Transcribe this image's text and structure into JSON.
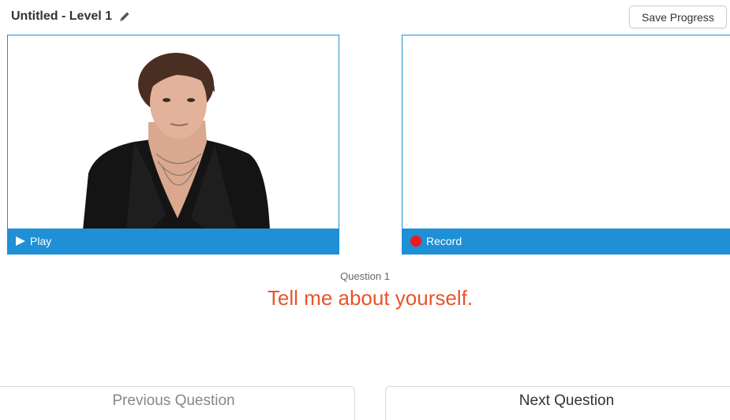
{
  "header": {
    "title": "Untitled - Level 1",
    "edit_icon": "pencil-icon",
    "save_label": "Save Progress"
  },
  "interviewer_panel": {
    "control_label": "Play",
    "control_icon": "play-icon"
  },
  "recorder_panel": {
    "control_label": "Record",
    "control_icon": "record-icon"
  },
  "question": {
    "number_label": "Question 1",
    "text": "Tell me about yourself."
  },
  "navigation": {
    "previous_label": "Previous Question",
    "next_label": "Next Question"
  },
  "colors": {
    "accent_blue": "#1f8fd6",
    "question_orange": "#e8542b",
    "record_red": "#f01818"
  }
}
